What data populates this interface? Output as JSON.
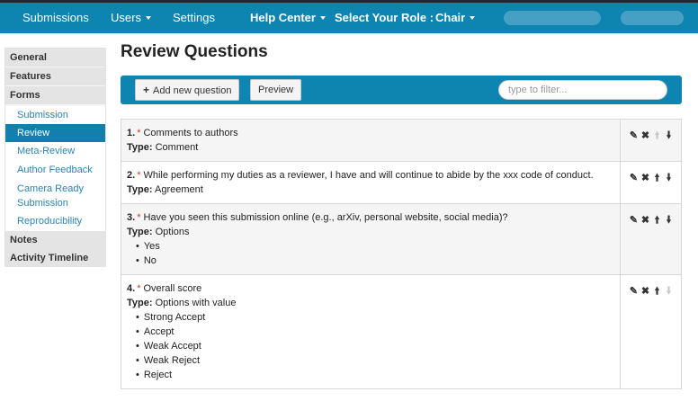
{
  "nav": {
    "submissions": "Submissions",
    "users": "Users",
    "settings": "Settings",
    "help_center": "Help Center",
    "role_label": "Select Your Role :",
    "role_value": "Chair"
  },
  "sidebar": {
    "general": "General",
    "features": "Features",
    "forms": "Forms",
    "forms_items": [
      "Submission",
      "Review",
      "Meta-Review",
      "Author Feedback",
      "Camera Ready Submission",
      "Reproducibility"
    ],
    "active_item": "Review",
    "notes": "Notes",
    "activity_timeline": "Activity Timeline"
  },
  "page": {
    "title": "Review Questions"
  },
  "toolbar": {
    "add_label": "Add new question",
    "preview_label": "Preview",
    "filter_placeholder": "type to filter..."
  },
  "type_label": "Type:",
  "questions": [
    {
      "num": "1.",
      "req": "*",
      "text": "Comments to authors",
      "type": "Comment",
      "options": []
    },
    {
      "num": "2.",
      "req": "*",
      "text": "While performing my duties as a reviewer, I have and will continue to abide by the xxx code of conduct.",
      "type": "Agreement",
      "options": []
    },
    {
      "num": "3.",
      "req": "*",
      "text": "Have you seen this submission online (e.g., arXiv, personal website, social media)?",
      "type": "Options",
      "options": [
        "Yes",
        "No"
      ]
    },
    {
      "num": "4.",
      "req": "*",
      "text": "Overall score",
      "type": "Options with value",
      "options": [
        "Strong Accept",
        "Accept",
        "Weak Accept",
        "Weak Reject",
        "Reject"
      ]
    }
  ],
  "colors": {
    "brand": "#0d85b0",
    "required": "#c0392b",
    "link": "#2a83b5"
  },
  "icons": {
    "edit": "edit-icon",
    "delete": "delete-icon",
    "up": "arrow-up-icon",
    "down": "arrow-down-icon"
  }
}
